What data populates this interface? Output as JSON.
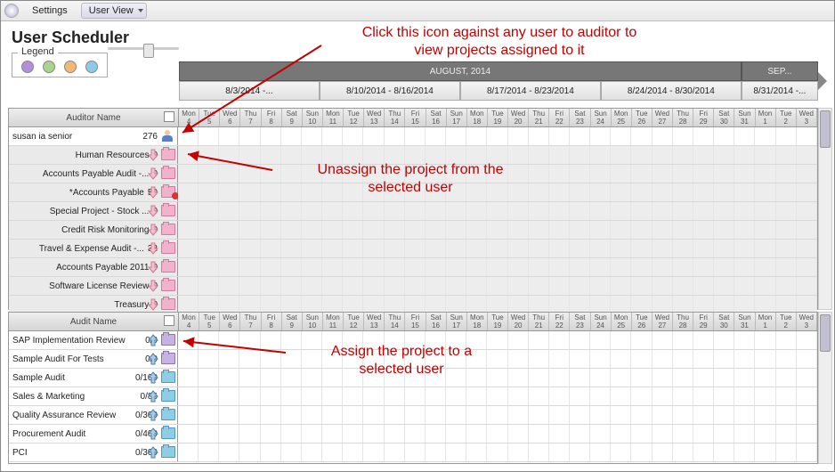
{
  "toolbar": {
    "settings": "Settings",
    "userview": "User View"
  },
  "title": "User Scheduler",
  "legend": {
    "label": "Legend",
    "dots": [
      "#b38fd9",
      "#a9d48f",
      "#f5b774",
      "#8fc9e8"
    ]
  },
  "timeline": {
    "months": [
      {
        "label": "AUGUST, 2014",
        "w": 88
      },
      {
        "label": "SEP...",
        "w": 12
      }
    ],
    "weeks": [
      "8/3/2014 -...",
      "8/10/2014 - 8/16/2014",
      "8/17/2014 - 8/23/2014",
      "8/24/2014 - 8/30/2014",
      "8/31/2014 -..."
    ],
    "days": [
      {
        "d": "Mon",
        "n": "4"
      },
      {
        "d": "Tue",
        "n": "5"
      },
      {
        "d": "Wed",
        "n": "6"
      },
      {
        "d": "Thu",
        "n": "7"
      },
      {
        "d": "Fri",
        "n": "8"
      },
      {
        "d": "Sat",
        "n": "9"
      },
      {
        "d": "Sun",
        "n": "10"
      },
      {
        "d": "Mon",
        "n": "11"
      },
      {
        "d": "Tue",
        "n": "12"
      },
      {
        "d": "Wed",
        "n": "13"
      },
      {
        "d": "Thu",
        "n": "14"
      },
      {
        "d": "Fri",
        "n": "15"
      },
      {
        "d": "Sat",
        "n": "16"
      },
      {
        "d": "Sun",
        "n": "17"
      },
      {
        "d": "Mon",
        "n": "18"
      },
      {
        "d": "Tue",
        "n": "19"
      },
      {
        "d": "Wed",
        "n": "20"
      },
      {
        "d": "Thu",
        "n": "21"
      },
      {
        "d": "Fri",
        "n": "22"
      },
      {
        "d": "Sat",
        "n": "23"
      },
      {
        "d": "Sun",
        "n": "24"
      },
      {
        "d": "Mon",
        "n": "25"
      },
      {
        "d": "Tue",
        "n": "26"
      },
      {
        "d": "Wed",
        "n": "27"
      },
      {
        "d": "Thu",
        "n": "28"
      },
      {
        "d": "Fri",
        "n": "29"
      },
      {
        "d": "Sat",
        "n": "30"
      },
      {
        "d": "Sun",
        "n": "31"
      },
      {
        "d": "Mon",
        "n": "1"
      },
      {
        "d": "Tue",
        "n": "2"
      },
      {
        "d": "Wed",
        "n": "3"
      }
    ]
  },
  "topHeader": "Auditor Name",
  "botHeader": "Audit Name",
  "user": {
    "name": "susan ia senior",
    "count": "276"
  },
  "assigned": [
    {
      "name": "Human Resources",
      "v": "0",
      "flag": false
    },
    {
      "name": "Accounts Payable Audit -...",
      "v": "0",
      "flag": false
    },
    {
      "name": "*Accounts Payable",
      "v": "50",
      "flag": true
    },
    {
      "name": "Special Project - Stock ...",
      "v": "0",
      "flag": false
    },
    {
      "name": "Credit Risk Monitoring",
      "v": "0",
      "flag": false
    },
    {
      "name": "Travel & Expense Audit -...",
      "v": "32",
      "flag": false
    },
    {
      "name": "Accounts Payable 2011",
      "v": "0",
      "flag": false
    },
    {
      "name": "Software License Review",
      "v": "0",
      "flag": false
    },
    {
      "name": "Treasury",
      "v": "0",
      "flag": false
    }
  ],
  "available": [
    {
      "name": "SAP Implementation Review",
      "v": "0/0",
      "color": "purple"
    },
    {
      "name": "Sample Audit For Tests",
      "v": "0/0",
      "color": "purple"
    },
    {
      "name": "Sample Audit",
      "v": "0/100",
      "color": "blue"
    },
    {
      "name": "Sales & Marketing",
      "v": "0/85",
      "color": "blue"
    },
    {
      "name": "Quality Assurance Review",
      "v": "0/300",
      "color": "blue"
    },
    {
      "name": "Procurement Audit",
      "v": "0/400",
      "color": "blue"
    },
    {
      "name": "PCI",
      "v": "0/300",
      "color": "blue"
    }
  ],
  "callouts": {
    "view": "Click this icon against any user to auditor to\nview projects assigned to it",
    "unassign": "Unassign the project from the\nselected user",
    "assign": "Assign the project to a\nselected user"
  }
}
